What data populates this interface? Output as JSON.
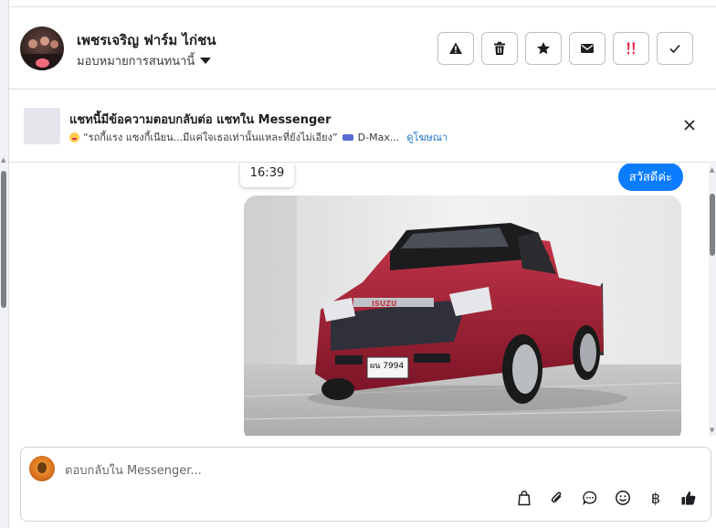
{
  "header": {
    "page_name": "เพชรเจริญ ฟาร์ม ไก่ชน",
    "assign_label": "มอบหมายการสนทนานี้",
    "actions": [
      {
        "name": "report-button",
        "icon": "warning-icon"
      },
      {
        "name": "delete-button",
        "icon": "trash-icon"
      },
      {
        "name": "star-button",
        "icon": "star-icon"
      },
      {
        "name": "mark-unread-button",
        "icon": "envelope-icon"
      },
      {
        "name": "follow-up-button",
        "icon": "double-exclamation-icon"
      },
      {
        "name": "mark-done-button",
        "icon": "checkmark-icon"
      }
    ]
  },
  "notice": {
    "title": "แชทนี้มีข้อความตอบกลับต่อ แชทใน Messenger",
    "quote": "“รถกี้แรง แซงกี้เนียน...มีแค่ใจเธอเท่านั้นแหละที่ยังไม่เอียง”",
    "product": "D-Max...",
    "link": "ดูโฆษณา"
  },
  "conversation": {
    "timestamp": "16:39",
    "message": "สวัสดีค่ะ",
    "image_plate": "ผน 7994"
  },
  "composer": {
    "placeholder": "ตอบกลับใน Messenger...",
    "tools": [
      "shopping-bag-icon",
      "paperclip-icon",
      "chat-bubble-icon",
      "smiley-icon",
      "baht-icon",
      "thumbs-up-icon"
    ],
    "baht_symbol": "฿"
  },
  "colors": {
    "accent": "#0a7cff",
    "link": "#1a73c7",
    "follow_up": "#e41e3f"
  }
}
